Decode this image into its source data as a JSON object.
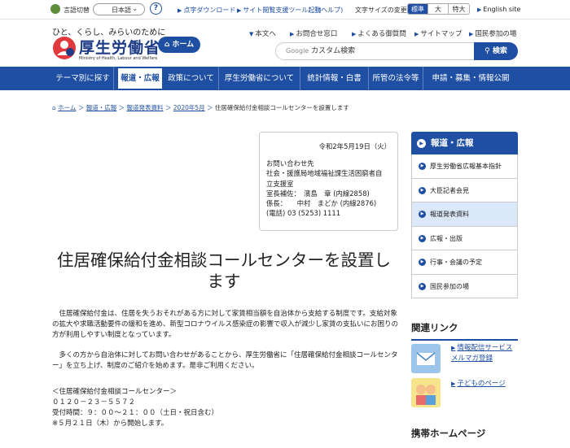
{
  "topbar": {
    "lang_label": "言語切替",
    "lang_value": "日本語",
    "help": "?",
    "braille": "点字ダウンロード",
    "support_tool": "サイト閲覧支援ツール起動",
    "support_help": "(ヘルプ)",
    "text_size_label": "文字サイズの変更",
    "size_standard": "標準",
    "size_large": "大",
    "size_xlarge": "特大",
    "english": "English site"
  },
  "header": {
    "tagline": "ひと、くらし、みらいのために",
    "logo_title": "厚生労働省",
    "logo_sub": "Ministry of Health, Labour and Welfare",
    "home_button": "ホーム",
    "links": [
      "本文へ",
      "お問合せ窓口",
      "よくある御質問",
      "サイトマップ",
      "国民参加の場"
    ],
    "search_engine": "Google",
    "search_placeholder": "カスタム検索",
    "search_button": "検索"
  },
  "nav": [
    "テーマ別に探す",
    "報道・広報",
    "政策について",
    "厚生労働省について",
    "統計情報・白書",
    "所管の法令等",
    "申請・募集・情報公開"
  ],
  "breadcrumb": [
    "ホーム",
    "報道・広報",
    "報道発表資料",
    "2020年5月",
    "住居確保給付金相談コールセンターを設置します"
  ],
  "info": {
    "date": "令和2年5月19日（火）",
    "lines": [
      "お問い合わせ先",
      "社会・援護局地域福祉課生活困窮者自",
      "立支援室",
      "室長補佐：　濱島　章 (内線2858)",
      "係長：　　中村　まどか (内線2876)",
      "(電話) 03 (5253) 1111"
    ]
  },
  "title_lines": [
    "住居確保給付金相談コールセンターを設置し",
    "ます"
  ],
  "paragraph1": "　住居確保給付金は、住居を失うおそれがある方に対して家賃相当額を自治体から支給する制度です。支給対象の拡大や求職活動要件の緩和を進め、新型コロナウイルス感染症の影響で収入が減少し家賃の支払いにお困りの方が利用しやすい制度となっています。",
  "paragraph2": "　多くの方から自治体に対してお問い合わせがあることから、厚生労働省に「住居確保給付金相談コールセンター」を立ち上げ、制度のご紹介を始めます。是非ご利用ください。",
  "center": [
    "＜住居確保給付金相談コールセンター＞",
    "０１２０－２３－５５７２",
    "受付時間：９：００～２１：００（土日・祝日含む）",
    "※５月２１日（木）から開始します。"
  ],
  "sidebar": {
    "head": "報道・広報",
    "items": [
      "厚生労働省広報基本指針",
      "大臣記者会見",
      "報道発表資料",
      "広報・出版",
      "行事・会議の予定",
      "国民参加の場"
    ]
  },
  "related": {
    "head": "関連リンク",
    "links": [
      "情報配信サービスメルマガ登録",
      "子どものページ"
    ]
  },
  "mobile_head": "携帯ホームページ"
}
